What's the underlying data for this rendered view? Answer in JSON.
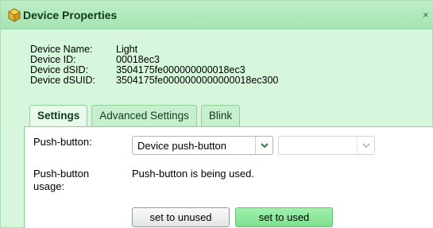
{
  "window": {
    "title": "Device Properties",
    "close_glyph": "×"
  },
  "device_info": {
    "rows": [
      {
        "label": "Device Name:",
        "value": "Light"
      },
      {
        "label": "Device ID:",
        "value": "00018ec3"
      },
      {
        "label": "Device dSID:",
        "value": "3504175fe000000000018ec3"
      },
      {
        "label": "Device dSUID:",
        "value": "3504175fe0000000000000018ec300"
      }
    ]
  },
  "tabs": [
    {
      "label": "Settings",
      "active": true
    },
    {
      "label": "Advanced Settings",
      "active": false
    },
    {
      "label": "Blink",
      "active": false
    }
  ],
  "settings": {
    "push_button_label": "Push-button:",
    "push_button_value": "Device push-button",
    "secondary_select_value": "",
    "usage_label_line1": "Push-button",
    "usage_label_line2": "usage:",
    "usage_status": "Push-button is being used.",
    "set_unused_label": "set to unused",
    "set_used_label": "set to used"
  },
  "colors": {
    "accent": "#a6e4b3",
    "panel_border": "#86d08f",
    "used_button": "#8ae899"
  },
  "icons": {
    "title": "cube-icon",
    "close": "close-icon",
    "dropdown": "chevron-down-icon"
  }
}
